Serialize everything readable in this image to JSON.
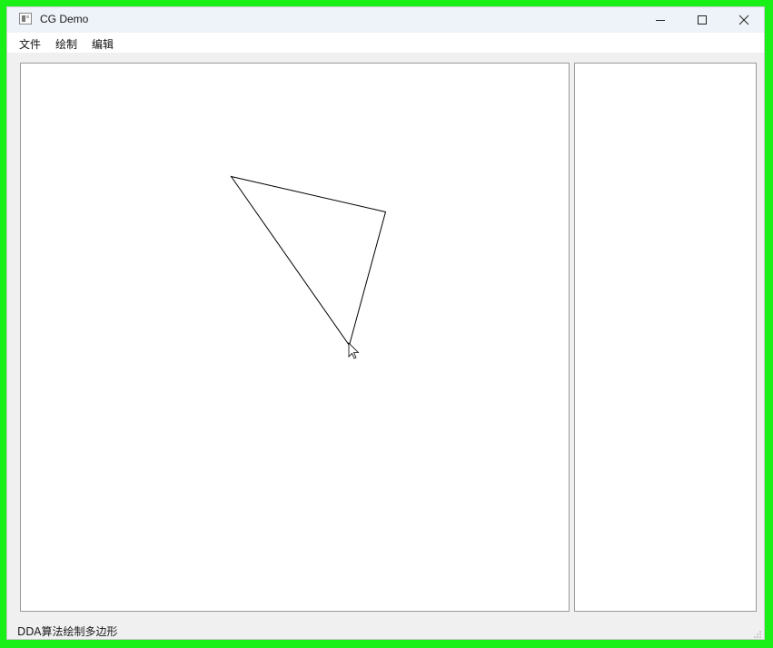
{
  "window": {
    "title": "CG Demo"
  },
  "title_buttons": {
    "minimize_icon": "minimize-icon",
    "maximize_icon": "maximize-icon",
    "close_icon": "close-icon"
  },
  "menubar": {
    "items": [
      {
        "label": "文件"
      },
      {
        "label": "绘制"
      },
      {
        "label": "编辑"
      }
    ]
  },
  "canvas": {
    "shape": "polygon",
    "stroke_color": "#000000",
    "background": "#ffffff"
  },
  "statusbar": {
    "text": "DDA算法绘制多边形"
  },
  "colors": {
    "frame": "#18f018",
    "titlebar": "#eef3f9",
    "window_bg": "#f0f0f0"
  }
}
